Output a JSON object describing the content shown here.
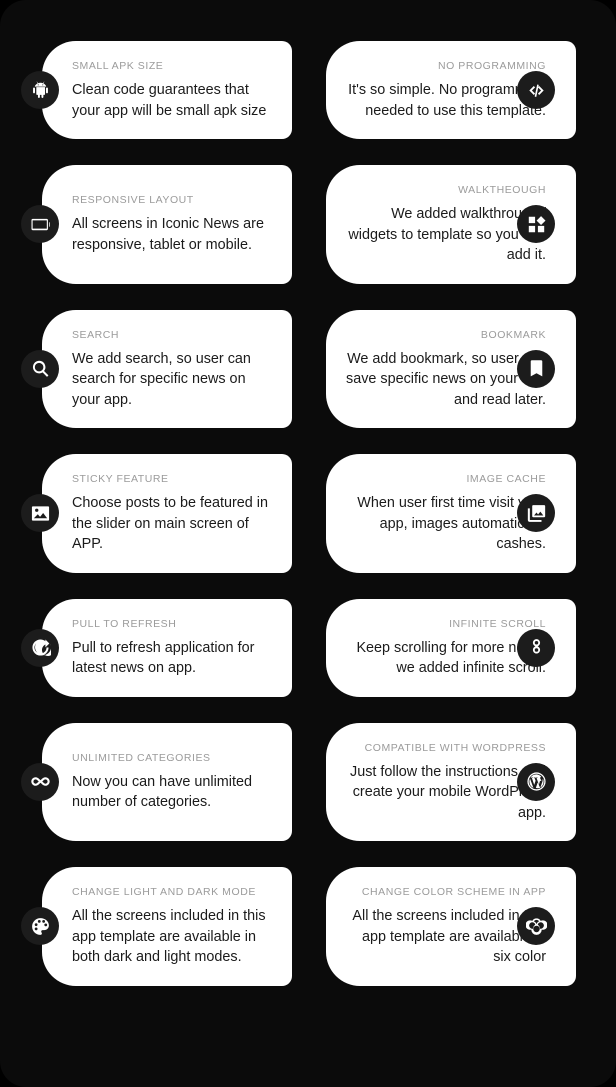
{
  "theme": {
    "page_background": "#000000",
    "panel_background": "#0b0b0b",
    "card_background": "#ffffff",
    "icon_badge_background": "#1c1c1c",
    "icon_color": "#ffffff",
    "kicker_color": "#9b9b9b",
    "body_text_color": "#1b1b1b"
  },
  "features": [
    {
      "id": "small-apk-size",
      "side": "left",
      "icon": "android-icon",
      "kicker": "SMALL APK SIZE",
      "body": "Clean code guarantees that your app will be small apk size"
    },
    {
      "id": "no-programming",
      "side": "right",
      "icon": "code-icon",
      "kicker": "NO PROGRAMMING",
      "body": "It's so simple. No programming needed to use this template."
    },
    {
      "id": "responsive-layout",
      "side": "left",
      "icon": "tablet-icon",
      "kicker": "RESPONSIVE LAYOUT",
      "body": "All screens in Iconic News are responsive, tablet or mobile."
    },
    {
      "id": "walkthrough",
      "side": "right",
      "icon": "widgets-icon",
      "kicker": "WALKTHEOUGH",
      "body": "We added walkthrough / widgets to template so you can add it."
    },
    {
      "id": "search",
      "side": "left",
      "icon": "search-icon",
      "kicker": "SEARCH",
      "body": "We add search, so user can search for specific news on your app."
    },
    {
      "id": "bookmark",
      "side": "right",
      "icon": "bookmark-icon",
      "kicker": "BOOKMARK",
      "body": "We add bookmark, so user can save specific news on your app and read later."
    },
    {
      "id": "sticky-feature",
      "side": "left",
      "icon": "image-icon",
      "kicker": "STICKY FEATURE",
      "body": "Choose posts to be featured in the slider on main screen of APP."
    },
    {
      "id": "image-cache",
      "side": "right",
      "icon": "photo-library-icon",
      "kicker": "IMAGE CACHE",
      "body": "When user first time visit your app, images automatically cashes."
    },
    {
      "id": "pull-to-refresh",
      "side": "left",
      "icon": "refresh-icon",
      "kicker": "PULL TO REFRESH",
      "body": "Pull to refresh application for latest news on app."
    },
    {
      "id": "infinite-scroll",
      "side": "right",
      "icon": "infinite-vertical-icon",
      "kicker": "INFINITE SCROLL",
      "body": "Keep scrolling for more news, we added infinite scroll."
    },
    {
      "id": "unlimited-categories",
      "side": "left",
      "icon": "infinity-icon",
      "kicker": "UNLIMITED CATEGORIES",
      "body": "Now you can have unlimited number of categories."
    },
    {
      "id": "compatible-with-wordpress",
      "side": "right",
      "icon": "wordpress-icon",
      "kicker": "COMPATIBLE WITH WORDPRESS",
      "body": "Just follow the instructions and create your mobile WordPress app."
    },
    {
      "id": "change-light-and-dark-mode",
      "side": "left",
      "icon": "palette-icon",
      "kicker": "CHANGE LIGHT AND DARK MODE",
      "body": "All the screens included in this app template are available in both dark and light modes."
    },
    {
      "id": "change-color-scheme-in-app",
      "side": "right",
      "icon": "color-lens-circles-icon",
      "kicker": "CHANGE COLOR SCHEME IN APP",
      "body": "All the screens included in this app template are available in six color"
    }
  ]
}
